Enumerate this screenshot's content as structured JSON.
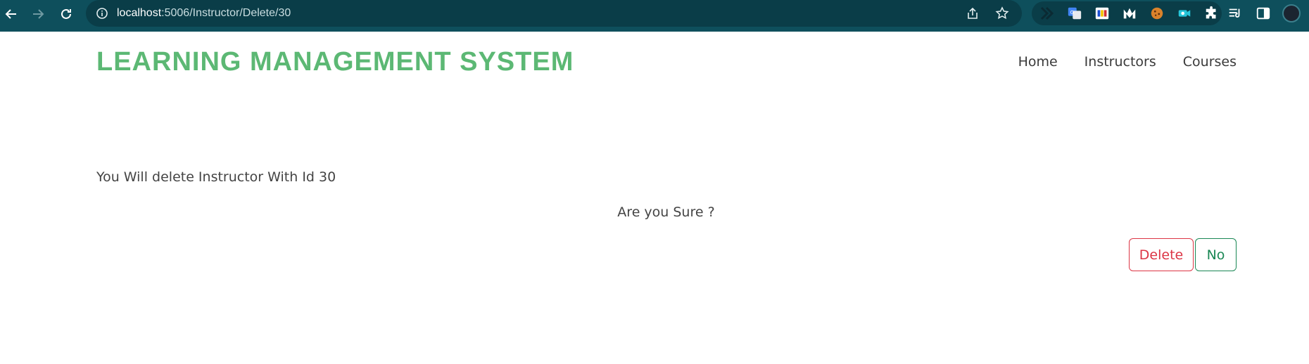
{
  "browser": {
    "url_host": "localhost",
    "url_path": ":5006/Instructor/Delete/30"
  },
  "site": {
    "brand": "LEARNING MANAGEMENT SYSTEM",
    "nav": [
      {
        "label": "Home"
      },
      {
        "label": "Instructors"
      },
      {
        "label": "Courses"
      }
    ]
  },
  "delete_page": {
    "message": "You Will delete Instructor With Id 30",
    "confirm": "Are you Sure ?",
    "delete_label": "Delete",
    "no_label": "No"
  },
  "colors": {
    "chrome": "#0e4f5c",
    "brand": "#5cb874",
    "danger": "#dc3545",
    "success": "#198754"
  }
}
